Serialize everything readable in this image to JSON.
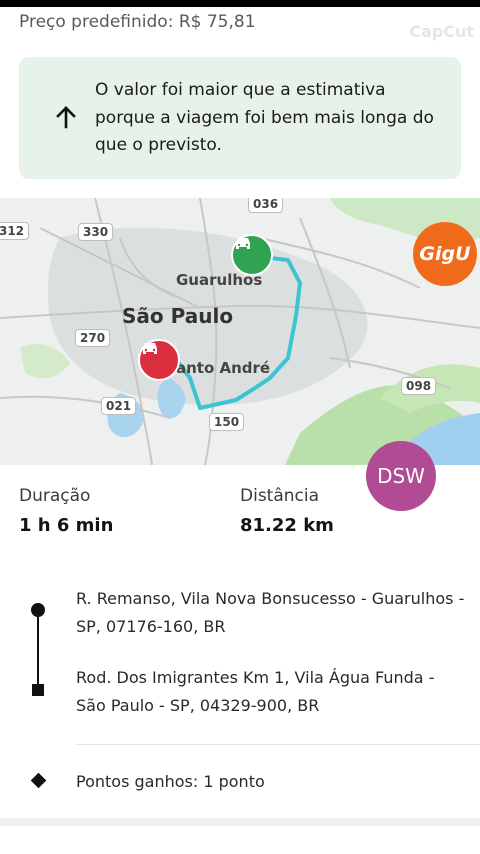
{
  "header": {
    "price_label": "Preço predefinido: R$ 75,81",
    "watermark": "CapCut"
  },
  "notice": {
    "icon": "arrow-up-icon",
    "text": "O valor foi maior que a estimativa porque a viagem foi bem mais longa do que o previsto."
  },
  "map": {
    "cities": {
      "sao_paulo": "São Paulo",
      "guarulhos": "Guarulhos",
      "santo_andre": "anto André"
    },
    "shields": [
      "036",
      "312",
      "330",
      "270",
      "021",
      "150",
      "098"
    ],
    "route_color": "#3cc4d0",
    "start_pin_color": "#30a353",
    "end_pin_color": "#dc2f3e",
    "overlay_logo": "GigU"
  },
  "overlay_badge": "DSW",
  "stats": {
    "duration_label": "Duração",
    "duration_value": "1 h 6 min",
    "distance_label": "Distância",
    "distance_value": "81.22 km"
  },
  "route": {
    "pickup": "R. Remanso, Vila Nova Bonsucesso - Guarulhos - SP, 07176-160, BR",
    "dropoff": "Rod. Dos Imigrantes Km 1, Vila Água Funda - São Paulo - SP, 04329-900, BR"
  },
  "points": {
    "label": "Pontos ganhos: 1 ponto"
  }
}
